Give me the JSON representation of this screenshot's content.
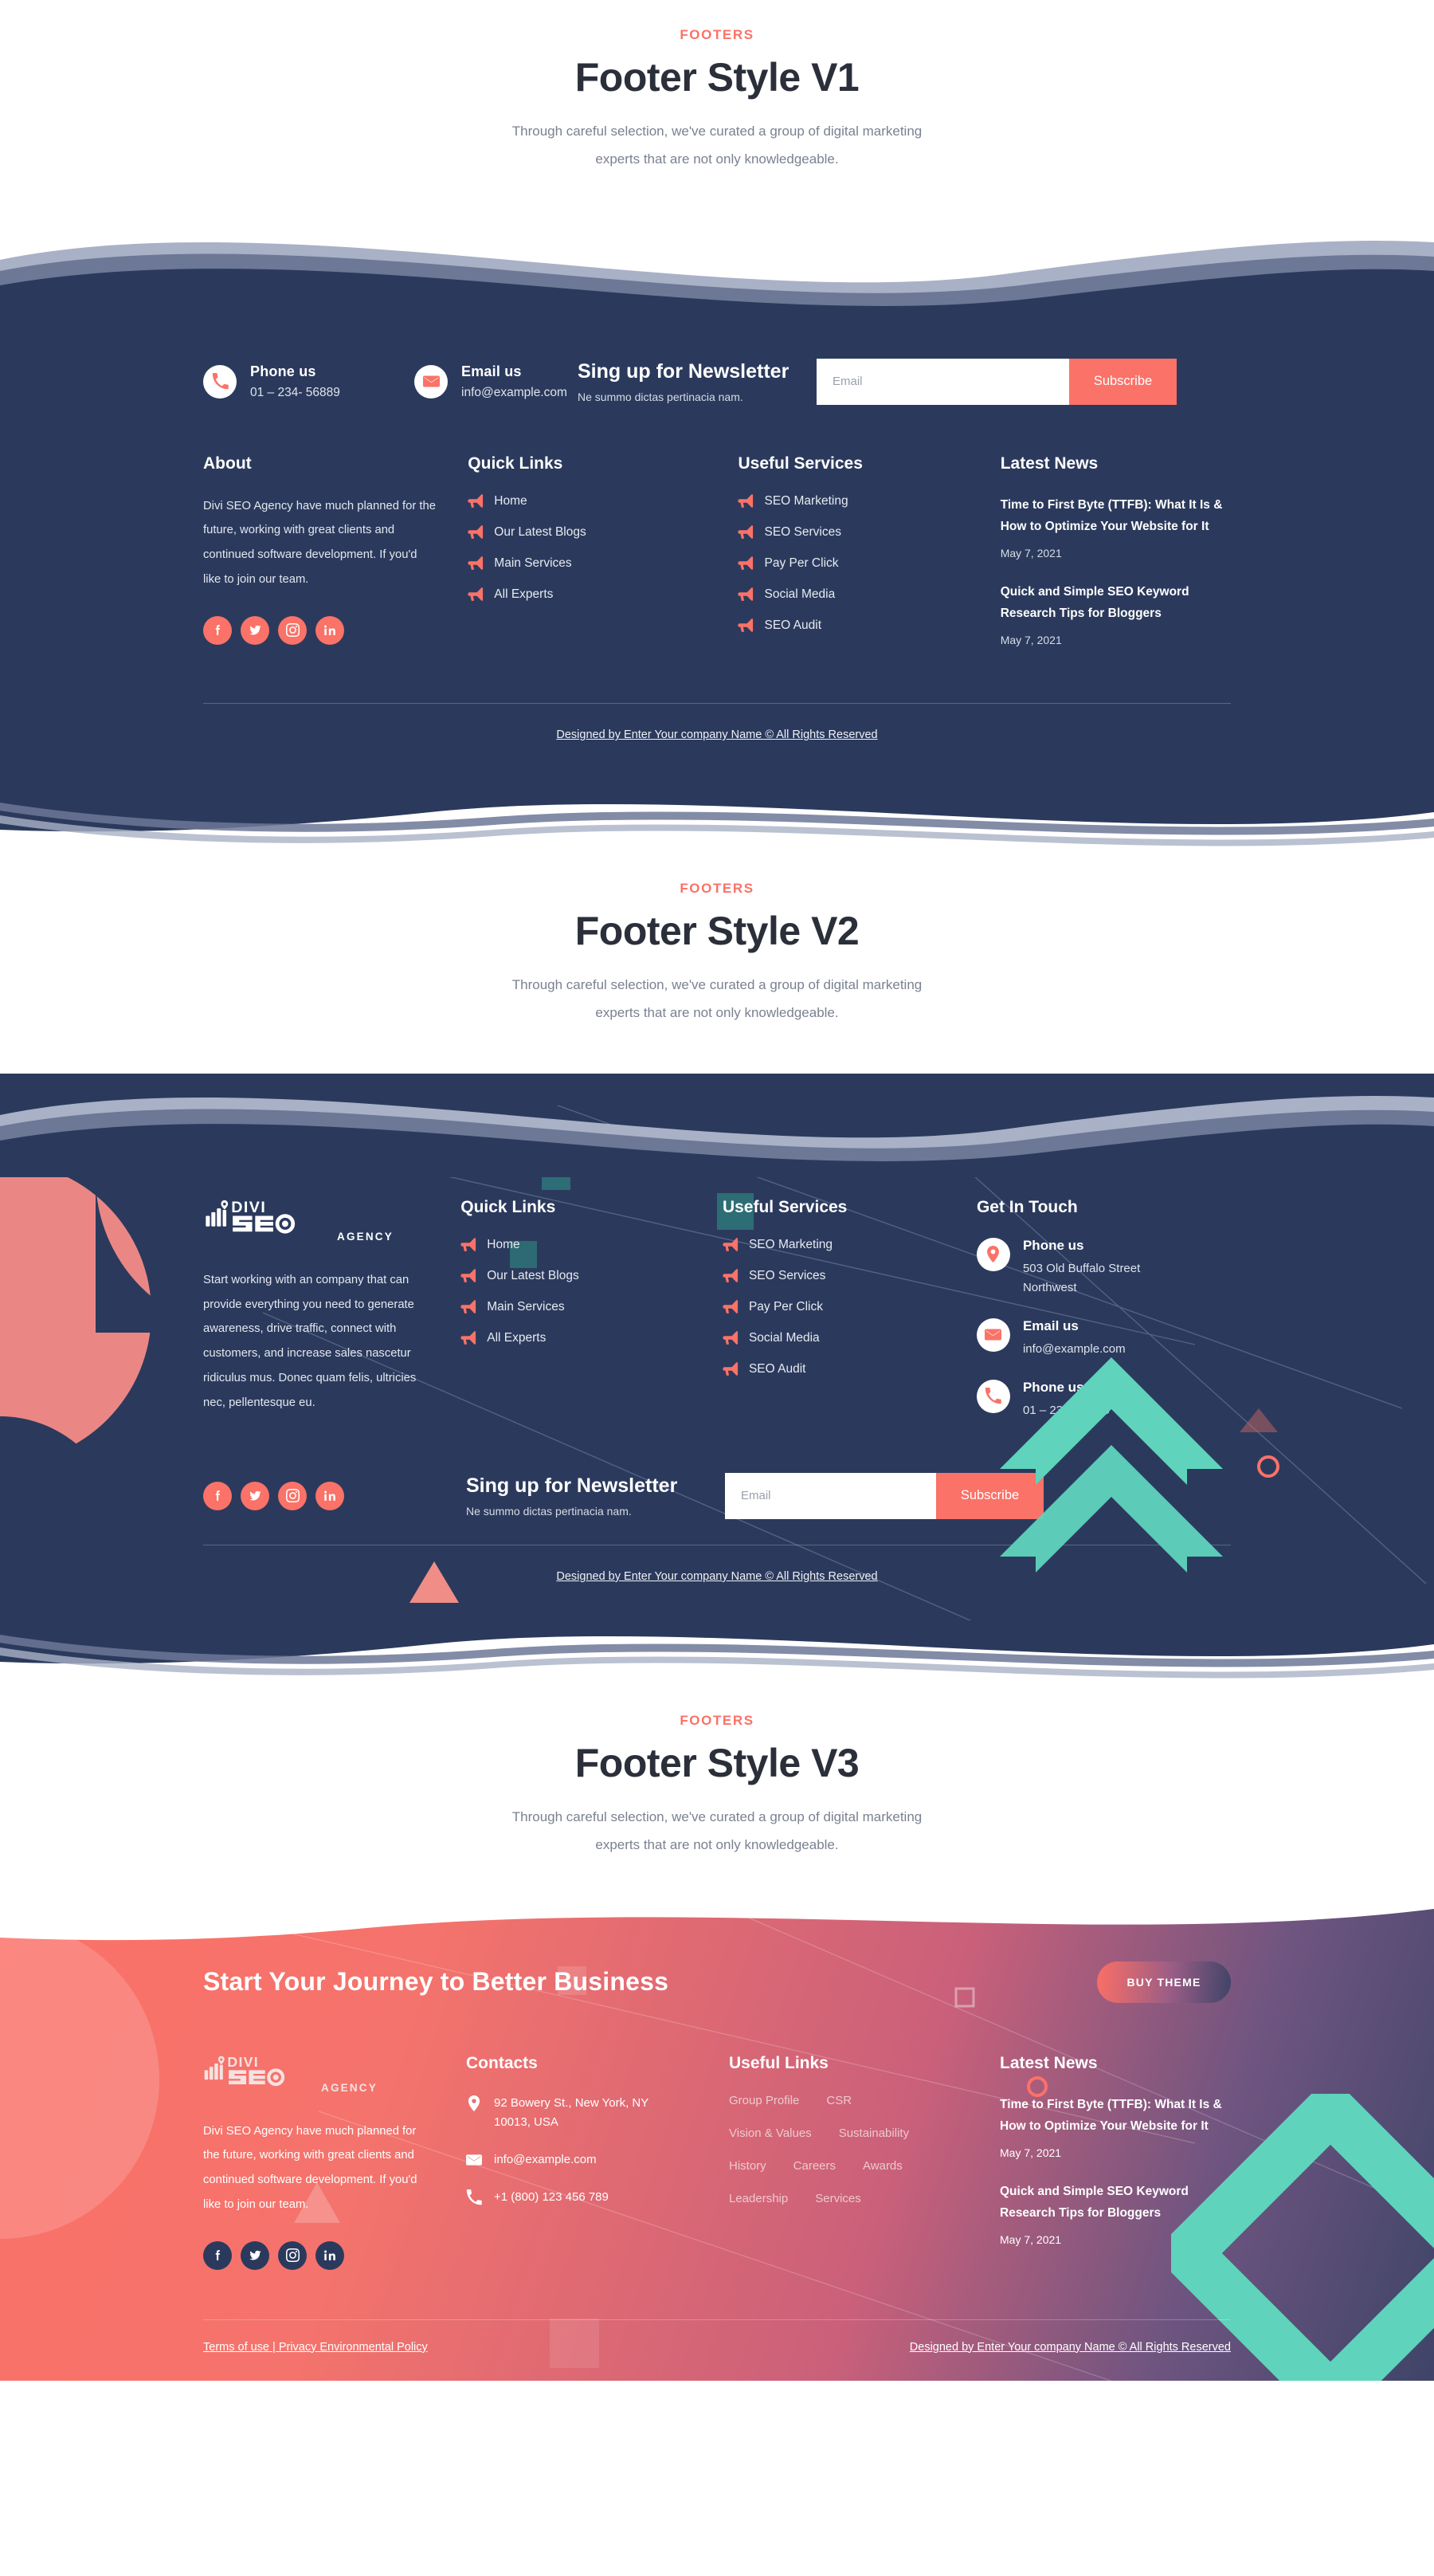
{
  "theme": {
    "navy": "#2b3a5c",
    "coral": "#fa7268",
    "teal": "#5fd3bc",
    "white": "#ffffff"
  },
  "sections": [
    {
      "eyebrow": "FOOTERS",
      "title": "Footer Style V1",
      "subtitle": "Through careful selection, we've curated a group of digital marketing experts that are not only knowledgeable."
    },
    {
      "eyebrow": "FOOTERS",
      "title": "Footer Style V2",
      "subtitle": "Through careful selection, we've curated a group of digital marketing experts that are not only knowledgeable."
    },
    {
      "eyebrow": "FOOTERS",
      "title": "Footer Style V3",
      "subtitle": "Through careful selection, we've curated a group of digital marketing experts that are not only knowledgeable."
    }
  ],
  "footer_v1": {
    "phone": {
      "label": "Phone us",
      "value": "01 – 234- 56889",
      "icon": "phone-icon"
    },
    "email": {
      "label": "Email us",
      "value": "info@example.com",
      "icon": "envelope-icon"
    },
    "newsletter": {
      "title": "Sing up for Newsletter",
      "subtitle": "Ne summo dictas pertinacia nam.",
      "placeholder": "Email",
      "button": "Subscribe"
    },
    "about": {
      "heading": "About",
      "text": "Divi SEO Agency have much planned for the future, working with great clients and continued software development. If you'd like to join our team."
    },
    "socials": [
      "facebook-icon",
      "twitter-icon",
      "instagram-icon",
      "linkedin-icon"
    ],
    "quick_links": {
      "heading": "Quick Links",
      "items": [
        "Home",
        "Our Latest Blogs",
        "Main Services",
        "All Experts"
      ]
    },
    "useful_services": {
      "heading": "Useful Services",
      "items": [
        "SEO Marketing",
        "SEO Services",
        "Pay Per Click",
        "Social Media",
        "SEO Audit"
      ]
    },
    "latest_news": {
      "heading": "Latest News",
      "items": [
        {
          "title": "Time to First Byte (TTFB): What It Is & How to Optimize Your Website for It",
          "date": "May 7, 2021"
        },
        {
          "title": "Quick and Simple SEO Keyword Research Tips for Bloggers",
          "date": "May 7, 2021"
        }
      ]
    },
    "copyright": "Designed by Enter Your company Name © All Rights Reserved"
  },
  "footer_v2": {
    "logo": {
      "name": "DIVI SEO",
      "suffix": "AGENCY"
    },
    "about_text": "Start working with an company that can provide everything you need to generate awareness, drive traffic, connect with customers, and increase sales nascetur ridiculus mus. Donec quam felis, ultricies nec, pellentesque eu.",
    "quick_links": {
      "heading": "Quick Links",
      "items": [
        "Home",
        "Our Latest Blogs",
        "Main Services",
        "All Experts"
      ]
    },
    "useful_services": {
      "heading": "Useful Services",
      "items": [
        "SEO Marketing",
        "SEO Services",
        "Pay Per Click",
        "Social Media",
        "SEO Audit"
      ]
    },
    "get_in_touch": {
      "heading": "Get In Touch",
      "items": [
        {
          "icon": "map-pin-icon",
          "label": "Phone us",
          "value": "503 Old Buffalo Street Northwest"
        },
        {
          "icon": "envelope-icon",
          "label": "Email us",
          "value": "info@example.com"
        },
        {
          "icon": "phone-icon",
          "label": "Phone us",
          "value": "01 – 234- 56889"
        }
      ]
    },
    "socials": [
      "facebook-icon",
      "twitter-icon",
      "instagram-icon",
      "linkedin-icon"
    ],
    "newsletter": {
      "title": "Sing up for Newsletter",
      "subtitle": "Ne summo dictas pertinacia nam.",
      "placeholder": "Email",
      "button": "Subscribe"
    },
    "copyright": "Designed by Enter Your company Name © All Rights Reserved"
  },
  "footer_v3": {
    "cta": {
      "title": "Start Your Journey to Better Business",
      "button": "BUY THEME"
    },
    "logo": {
      "name": "DIVI SEO",
      "suffix": "AGENCY"
    },
    "about_text": "Divi SEO Agency have much planned for the future, working with great clients and continued software development. If you'd like to join our team.",
    "socials": [
      "facebook-icon",
      "twitter-icon",
      "instagram-icon",
      "linkedin-icon"
    ],
    "contacts": {
      "heading": "Contacts",
      "items": [
        {
          "icon": "map-pin-icon",
          "value": "92 Bowery St., New York, NY 10013, USA"
        },
        {
          "icon": "envelope-icon",
          "value": "info@example.com"
        },
        {
          "icon": "phone-icon",
          "value": "+1 (800) 123 456 789"
        }
      ]
    },
    "useful_links": {
      "heading": "Useful Links",
      "items": [
        "Group Profile",
        "CSR",
        "Vision & Values",
        "Sustainability",
        "History",
        "Careers",
        "Awards",
        "Leadership",
        "Services"
      ]
    },
    "latest_news": {
      "heading": "Latest News",
      "items": [
        {
          "title": "Time to First Byte (TTFB): What It Is & How to Optimize Your Website for It",
          "date": "May 7, 2021"
        },
        {
          "title": "Quick and Simple SEO Keyword Research Tips for Bloggers",
          "date": "May 7, 2021"
        }
      ]
    },
    "terms": "Terms of use | Privacy Environmental Policy",
    "copyright": "Designed by Enter Your company Name © All Rights Reserved"
  }
}
